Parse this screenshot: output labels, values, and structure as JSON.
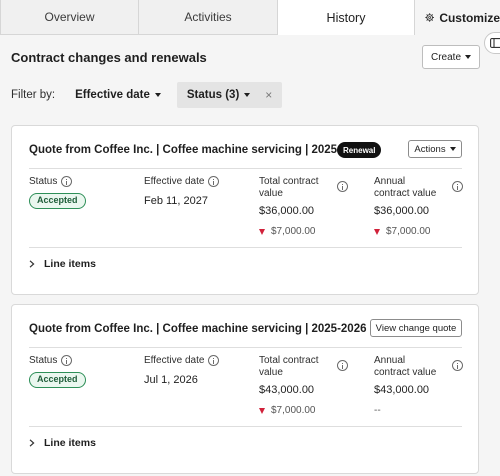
{
  "tabs": [
    {
      "label": "Overview"
    },
    {
      "label": "Activities"
    },
    {
      "label": "History"
    },
    {
      "label": "Customize"
    }
  ],
  "section": {
    "title": "Contract changes and renewals",
    "create_label": "Create"
  },
  "filter": {
    "label": "Filter by:",
    "effective_date": "Effective date",
    "status": "Status (3)",
    "clear": "×"
  },
  "cards": [
    {
      "title": "Quote from Coffee Inc. | Coffee machine servicing | 2025-2026",
      "badge": "Renewal",
      "button": "Actions",
      "status_label": "Status",
      "status_value": "Accepted",
      "eff_label": "Effective date",
      "eff_value": "Feb 11, 2027",
      "total_label": "Total contract value",
      "total_value": "$36,000.00",
      "total_delta": "$7,000.00",
      "annual_label": "Annual contract value",
      "annual_value": "$36,000.00",
      "annual_delta": "$7,000.00",
      "line_items": "Line items"
    },
    {
      "title": "Quote from Coffee Inc. | Coffee machine servicing | 2025-2026",
      "button": "View change quote",
      "status_label": "Status",
      "status_value": "Accepted",
      "eff_label": "Effective date",
      "eff_value": "Jul 1, 2026",
      "total_label": "Total contract value",
      "total_value": "$43,000.00",
      "total_delta": "$7,000.00",
      "annual_label": "Annual contract value",
      "annual_value": "$43,000.00",
      "annual_delta": "--",
      "line_items": "Line items"
    }
  ],
  "colors": {
    "accent_green": "#2e8f58",
    "delta_red": "#d1213a",
    "badge_black": "#111111"
  },
  "icons": {
    "customize": "gear-icon",
    "info": "info-icon",
    "delta": "down-triangle-icon",
    "expand": "chevron-right-icon",
    "side_panel": "panel-icon"
  }
}
